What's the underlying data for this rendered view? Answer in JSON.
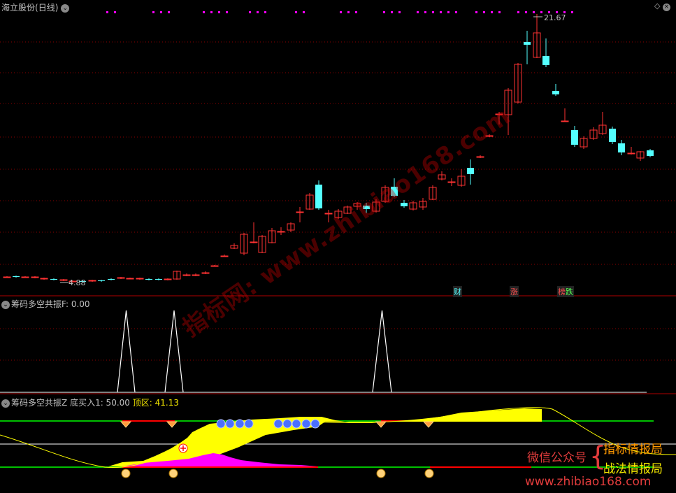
{
  "stock": {
    "name": "海立股份",
    "period": "(日线)"
  },
  "price": {
    "high_label": "21.67",
    "low_label": "4.88"
  },
  "badges": {
    "cai": "财",
    "zhang": "涨",
    "bang": "榜",
    "die": "跌"
  },
  "panel2": {
    "name": "筹码多空共振F",
    "value_text": ": 0.00"
  },
  "panel3": {
    "name": "筹码多空共振Z",
    "buy_label": "底买入1: 50.00",
    "top_label": "顶区: 41.13"
  },
  "watermark": {
    "text": "指标网: www.zhibiao168.com",
    "promo_wechat": "微信公众号",
    "promo_line1": "指标情报局",
    "promo_line2": "战法情报局",
    "url": "www.zhibiao168.com"
  },
  "colors": {
    "up": "#ff3232",
    "down": "#54ffff",
    "grid": "#8b0000",
    "yellow": "#ffff00",
    "magenta": "#ff00ff"
  }
}
